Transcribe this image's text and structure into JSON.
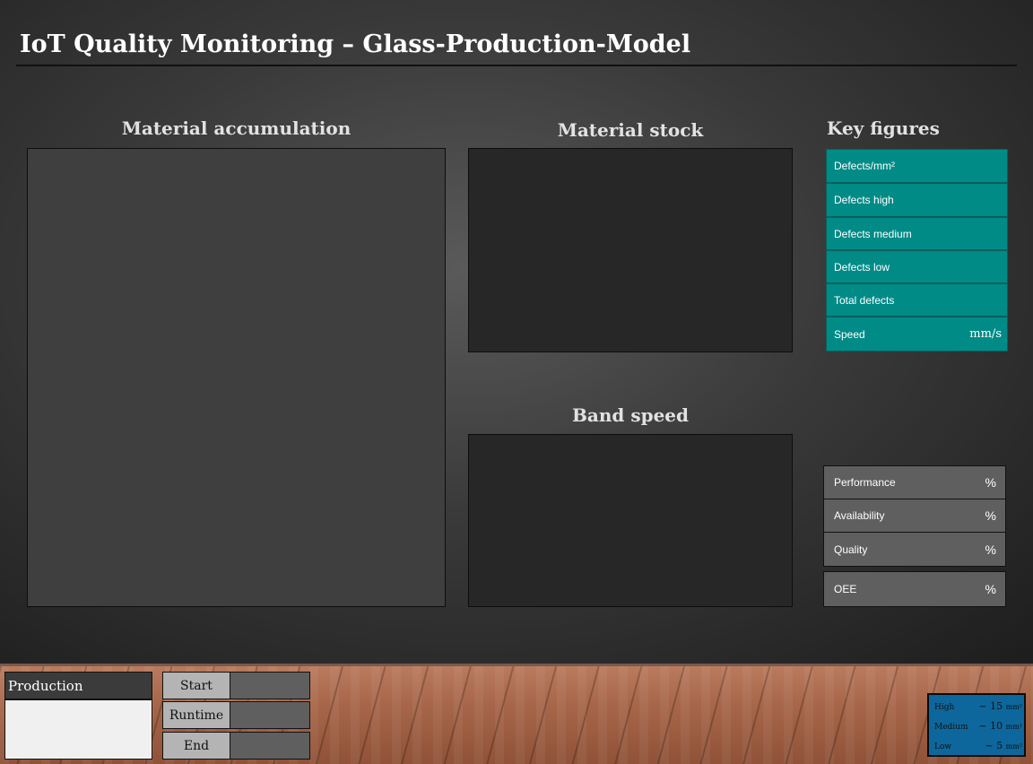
{
  "header": {
    "title": "IoT Quality Monitoring – Glass-Production-Model"
  },
  "panels": {
    "material_accumulation": "Material accumulation",
    "material_stock": "Material stock",
    "band_speed": "Band speed",
    "key_figures": "Key figures"
  },
  "key_figures": [
    {
      "label": "Defects/mm²",
      "unit": ""
    },
    {
      "label": "Defects high",
      "unit": ""
    },
    {
      "label": "Defects medium",
      "unit": ""
    },
    {
      "label": "Defects low",
      "unit": ""
    },
    {
      "label": "Total defects",
      "unit": ""
    },
    {
      "label": "Speed",
      "unit": "mm/s"
    }
  ],
  "oee": [
    {
      "label": "Performance",
      "unit": "%"
    },
    {
      "label": "Availability",
      "unit": "%"
    },
    {
      "label": "Quality",
      "unit": "%"
    },
    {
      "label": "OEE",
      "unit": "%"
    }
  ],
  "production": {
    "label": "Production",
    "value": ""
  },
  "controls": [
    {
      "label": "Start",
      "value": ""
    },
    {
      "label": "Runtime",
      "value": ""
    },
    {
      "label": "End",
      "value": ""
    }
  ],
  "legend": [
    {
      "label": "High",
      "value": "~ 15",
      "unit": "mm²"
    },
    {
      "label": "Medium",
      "value": "~ 10",
      "unit": "mm²"
    },
    {
      "label": "Low",
      "value": "~ 5",
      "unit": "mm²"
    }
  ],
  "colors": {
    "key_figure_bg": "#008b87",
    "legend_bg": "#0e679c",
    "oee_bg": "#5f5f5f"
  }
}
